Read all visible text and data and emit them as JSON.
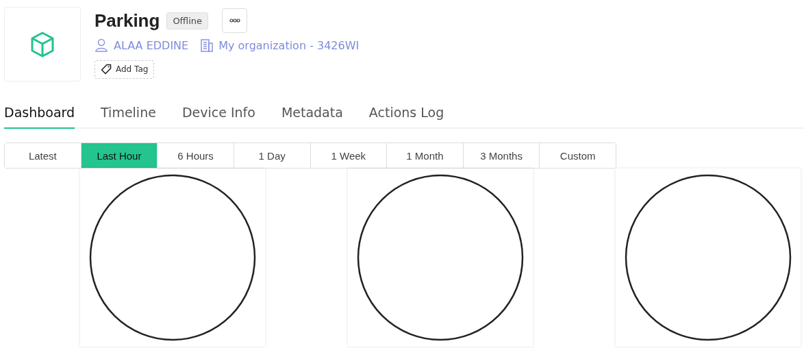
{
  "device": {
    "name": "Parking",
    "status": "Offline",
    "owner": "ALAA EDDINE",
    "organization": "My organization - 3426WI",
    "add_tag": "Add Tag"
  },
  "tabs": [
    {
      "label": "Dashboard",
      "selected": true
    },
    {
      "label": "Timeline",
      "selected": false
    },
    {
      "label": "Device Info",
      "selected": false
    },
    {
      "label": "Metadata",
      "selected": false
    },
    {
      "label": "Actions Log",
      "selected": false
    }
  ],
  "ranges": [
    {
      "label": "Latest",
      "selected": false
    },
    {
      "label": "Last Hour",
      "selected": true
    },
    {
      "label": "6 Hours",
      "selected": false
    },
    {
      "label": "1 Day",
      "selected": false
    },
    {
      "label": "1 Week",
      "selected": false
    },
    {
      "label": "1 Month",
      "selected": false
    },
    {
      "label": "3 Months",
      "selected": false
    },
    {
      "label": "Custom",
      "selected": false
    }
  ],
  "widgets": [
    {
      "kind": "gauge"
    },
    {
      "kind": "gauge"
    },
    {
      "kind": "gauge"
    }
  ]
}
